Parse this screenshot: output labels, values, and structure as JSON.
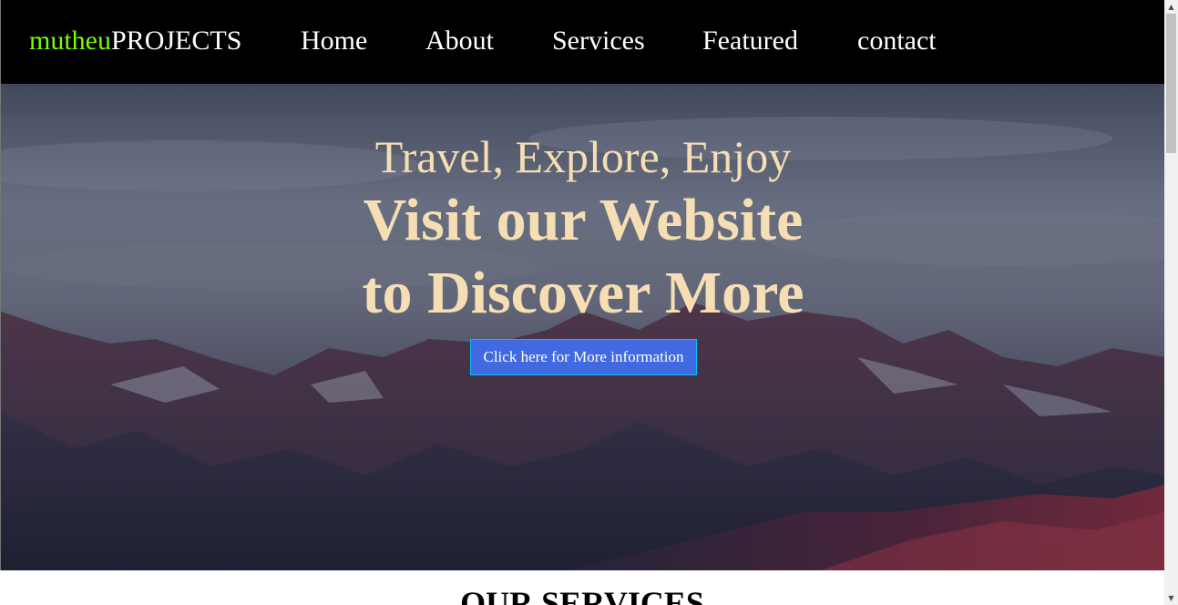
{
  "navbar": {
    "logo_accent": "mutheu",
    "logo_main": "PROJECTS",
    "links": [
      "Home",
      "About",
      "Services",
      "Featured",
      "contact"
    ],
    "colors": {
      "background": "#000000",
      "link": "#ffffff",
      "logo_accent": "#7cfc00"
    }
  },
  "hero": {
    "subtitle": "Travel, Explore, Enjoy",
    "title_line1": "Visit our Website",
    "title_line2": "to Discover More",
    "cta_label": "Click here for More information",
    "background_image": "mountain-landscape",
    "colors": {
      "text": "#f5deb3",
      "cta_bg": "#4169e1",
      "cta_border": "#00bfff"
    }
  },
  "services": {
    "heading": "OUR SERVICES"
  },
  "scrollbar": {
    "up_icon": "triangle-up-icon",
    "down_icon": "triangle-down-icon"
  }
}
